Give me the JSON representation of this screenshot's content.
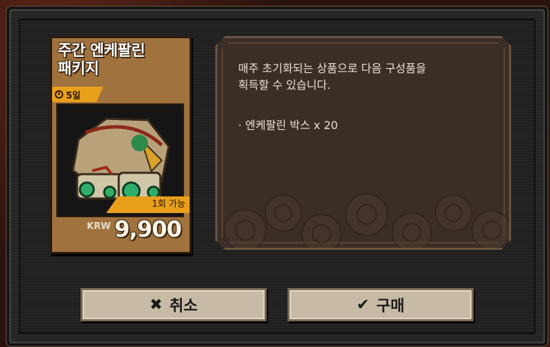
{
  "package": {
    "title": "주간 엔케팔린\n패키지",
    "title_line1": "주간 엔케팔린",
    "title_line2": "패키지",
    "timer": "5일",
    "purchase_limit": "1회 가능",
    "currency": "KRW",
    "price": "9,900"
  },
  "description": {
    "text_line1": "매주 초기화되는 상품으로 다음 구성품을",
    "text_line2": "획득할 수 있습니다.",
    "item": "· 엔케팔린 박스 x 20"
  },
  "buttons": {
    "cancel_label": "취소",
    "cancel_icon": "close-icon",
    "buy_label": "구매",
    "buy_icon": "check-icon"
  },
  "colors": {
    "card": "#a0723e",
    "accent": "#e8a01a",
    "button": "#c7bba6",
    "panel": "#3a2e26"
  }
}
